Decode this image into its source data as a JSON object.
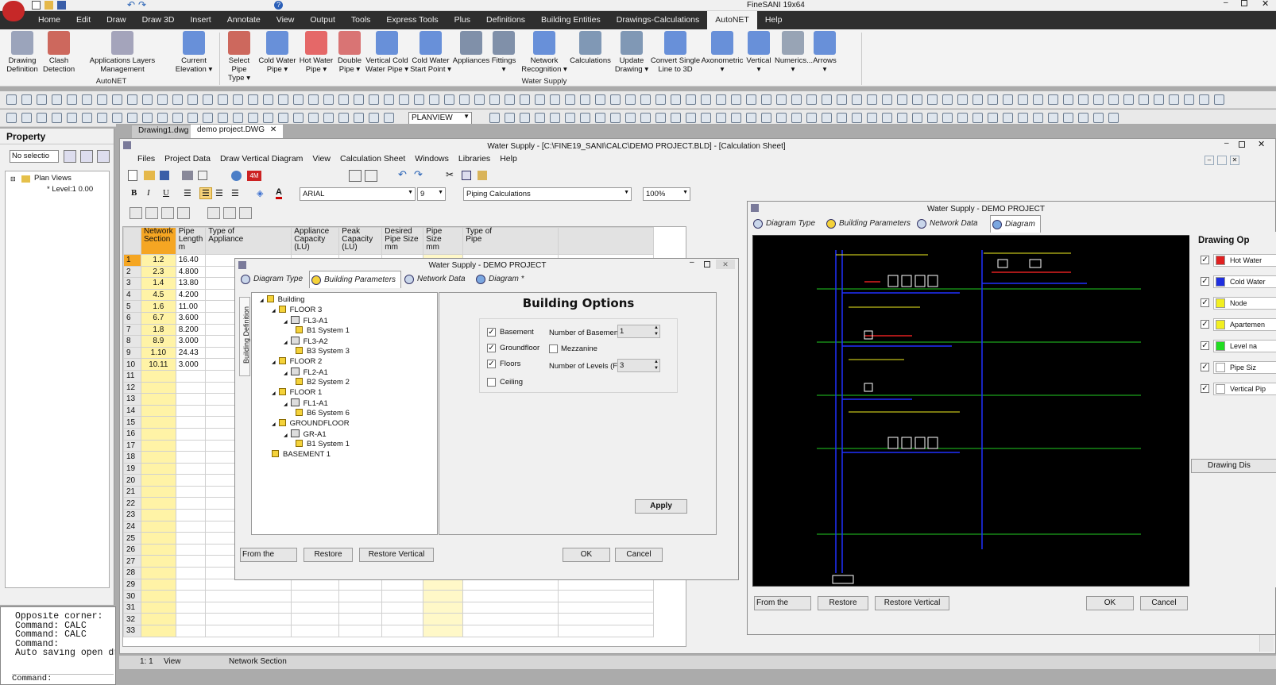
{
  "app": {
    "title": "FineSANI 19x64"
  },
  "menu": [
    "Home",
    "Edit",
    "Draw",
    "Draw 3D",
    "Insert",
    "Annotate",
    "View",
    "Output",
    "Tools",
    "Express Tools",
    "Plus",
    "Definitions",
    "Building Entities",
    "Drawings-Calculations",
    "AutoNET",
    "Help"
  ],
  "ribbon": {
    "autonet": {
      "label": "AutoNET",
      "buttons": [
        {
          "label": "Drawing\nDefinition",
          "icon": "drawing-definition-icon"
        },
        {
          "label": "Clash\nDetection",
          "icon": "clash-detection-icon"
        },
        {
          "label": "Applications Layers\nManagement",
          "icon": "layers-icon"
        },
        {
          "label": "Current\nElevation ▾",
          "icon": "elevation-icon"
        }
      ]
    },
    "watersupply": {
      "label": "Water Supply",
      "buttons": [
        {
          "label": "Select Pipe\nType ▾",
          "icon": "select-pipe-icon"
        },
        {
          "label": "Cold Water\nPipe ▾",
          "icon": "cold-pipe-icon"
        },
        {
          "label": "Hot Water\nPipe ▾",
          "icon": "hot-pipe-icon"
        },
        {
          "label": "Double\nPipe ▾",
          "icon": "double-pipe-icon"
        },
        {
          "label": "Vertical Cold\nWater Pipe ▾",
          "icon": "vertical-pipe-icon"
        },
        {
          "label": "Cold Water\nStart Point ▾",
          "icon": "start-point-icon"
        },
        {
          "label": "Appliances",
          "icon": "appliances-icon"
        },
        {
          "label": "Fittings\n▾",
          "icon": "fittings-icon"
        },
        {
          "label": "Network\nRecognition ▾",
          "icon": "network-recognition-icon"
        },
        {
          "label": "Calculations",
          "icon": "calculations-icon"
        },
        {
          "label": "Update\nDrawing ▾",
          "icon": "update-drawing-icon"
        },
        {
          "label": "Convert Single\nLine to 3D",
          "icon": "convert-3d-icon"
        },
        {
          "label": "Axonometric\n▾",
          "icon": "axonometric-icon"
        },
        {
          "label": "Vertical\n▾",
          "icon": "vertical-icon"
        },
        {
          "label": "Numerics...\n▾",
          "icon": "numerics-icon"
        },
        {
          "label": "Arrows\n▾",
          "icon": "arrows-icon"
        }
      ]
    }
  },
  "toolbar": {
    "layer_combo": "PLANVIEW"
  },
  "property": {
    "title": "Property",
    "selection": "No selectio",
    "tree_root": "Plan Views",
    "tree_child": "* Level:1 0.00"
  },
  "doc_tabs": [
    "Drawing1.dwg",
    "demo project.DWG"
  ],
  "command": {
    "lines": [
      "Opposite corner:",
      "Command: CALC",
      "Command: CALC",
      "Command:",
      "Auto saving open dr"
    ],
    "prompt": "Command:"
  },
  "status": {
    "scale": "1: 1",
    "view": "View",
    "field": "Network Section"
  },
  "calc": {
    "title": "Water Supply - [C:\\FINE19_SANI\\CALC\\DEMO PROJECT.BLD] - [Calculation Sheet]",
    "menu": [
      "Files",
      "Project Data",
      "Draw Vertical Diagram",
      "View",
      "Calculation Sheet",
      "Windows",
      "Libraries",
      "Help"
    ],
    "font": "ARIAL",
    "font_size": "9",
    "sheet": "Piping Calculations",
    "zoom": "100%",
    "columns": [
      "Network\nSection",
      "Pipe\nLength\nm",
      "Type of\nAppliance",
      "Appliance\nCapacity\n(LU)",
      "Peak\nCapacity\n(LU)",
      "Desired\nPipe Size\nmm",
      "Pipe\nSize\nmm",
      "Type of\nPipe"
    ],
    "rows": [
      {
        "n": "1",
        "section": "1.2",
        "length": "16.40"
      },
      {
        "n": "2",
        "section": "2.3",
        "length": "4.800"
      },
      {
        "n": "3",
        "section": "1.4",
        "length": "13.80"
      },
      {
        "n": "4",
        "section": "4.5",
        "length": "4.200"
      },
      {
        "n": "5",
        "section": "1.6",
        "length": "11.00"
      },
      {
        "n": "6",
        "section": "6.7",
        "length": "3.600"
      },
      {
        "n": "7",
        "section": "1.8",
        "length": "8.200"
      },
      {
        "n": "8",
        "section": "8.9",
        "length": "3.000"
      },
      {
        "n": "9",
        "section": "1.10",
        "length": "24.43"
      },
      {
        "n": "10",
        "section": "10.11",
        "length": "3.000"
      },
      {
        "n": "11"
      },
      {
        "n": "12"
      },
      {
        "n": "13"
      },
      {
        "n": "14"
      },
      {
        "n": "15"
      },
      {
        "n": "16"
      },
      {
        "n": "17"
      },
      {
        "n": "18"
      },
      {
        "n": "19"
      },
      {
        "n": "20"
      },
      {
        "n": "21"
      },
      {
        "n": "22"
      },
      {
        "n": "23"
      },
      {
        "n": "24"
      },
      {
        "n": "25"
      },
      {
        "n": "26"
      },
      {
        "n": "27"
      },
      {
        "n": "28"
      },
      {
        "n": "29"
      },
      {
        "n": "30"
      },
      {
        "n": "31"
      },
      {
        "n": "32"
      },
      {
        "n": "33"
      }
    ]
  },
  "dialog": {
    "title": "Water Supply - DEMO PROJECT",
    "tabs": [
      "Diagram Type",
      "Building Parameters",
      "Network Data",
      "Diagram *"
    ],
    "side_label": "Building Definition",
    "tree": [
      {
        "label": "Building",
        "level": 0
      },
      {
        "label": "FLOOR 3",
        "level": 1
      },
      {
        "label": "FL3-A1",
        "level": 2
      },
      {
        "label": "B1 System 1",
        "level": 3
      },
      {
        "label": "FL3-A2",
        "level": 2
      },
      {
        "label": "B3 System 3",
        "level": 3
      },
      {
        "label": "FLOOR 2",
        "level": 1
      },
      {
        "label": "FL2-A1",
        "level": 2
      },
      {
        "label": "B2 System 2",
        "level": 3
      },
      {
        "label": "FLOOR 1",
        "level": 1
      },
      {
        "label": "FL1-A1",
        "level": 2
      },
      {
        "label": "B6 System 6",
        "level": 3
      },
      {
        "label": "GROUNDFLOOR",
        "level": 1
      },
      {
        "label": "GR-A1",
        "level": 2
      },
      {
        "label": "B1 System 1",
        "level": 3
      },
      {
        "label": "BASEMENT 1",
        "level": 1
      }
    ],
    "options_title": "Building Options",
    "basement_label": "Basement",
    "groundfloor_label": "Groundfloor",
    "floors_label": "Floors",
    "ceiling_label": "Ceiling",
    "mezzanine_label": "Mezzanine",
    "num_basements_label": "Number of Basements",
    "num_basements_value": "1",
    "num_levels_label": "Number of Levels (Flo",
    "num_levels_value": "3",
    "apply": "Apply",
    "from_beginning": "From the beginning",
    "restore": "Restore",
    "restore_vertical": "Restore Vertical Pipes",
    "ok": "OK",
    "cancel": "Cancel"
  },
  "diagram_win": {
    "title": "Water Supply - DEMO PROJECT",
    "tabs": [
      "Diagram Type",
      "Building Parameters",
      "Network Data",
      "Diagram"
    ],
    "options_title": "Drawing Op",
    "options": [
      {
        "label": "Hot Water",
        "color": "#e02020"
      },
      {
        "label": "Cold Water",
        "color": "#1f2fe0"
      },
      {
        "label": "Node",
        "color": "#f2ef20"
      },
      {
        "label": "Apartemen",
        "color": "#f2ef20"
      },
      {
        "label": "Level na",
        "color": "#22dd22"
      },
      {
        "label": "Pipe Siz",
        "color": "#ffffff"
      },
      {
        "label": "Vertical Pip",
        "color": "#ffffff"
      }
    ],
    "drawing_btn": "Drawing Dis",
    "from_beginning": "From the beginning",
    "restore": "Restore",
    "restore_vertical": "Restore Vertical Pipes",
    "ok": "OK",
    "cancel": "Cancel"
  }
}
